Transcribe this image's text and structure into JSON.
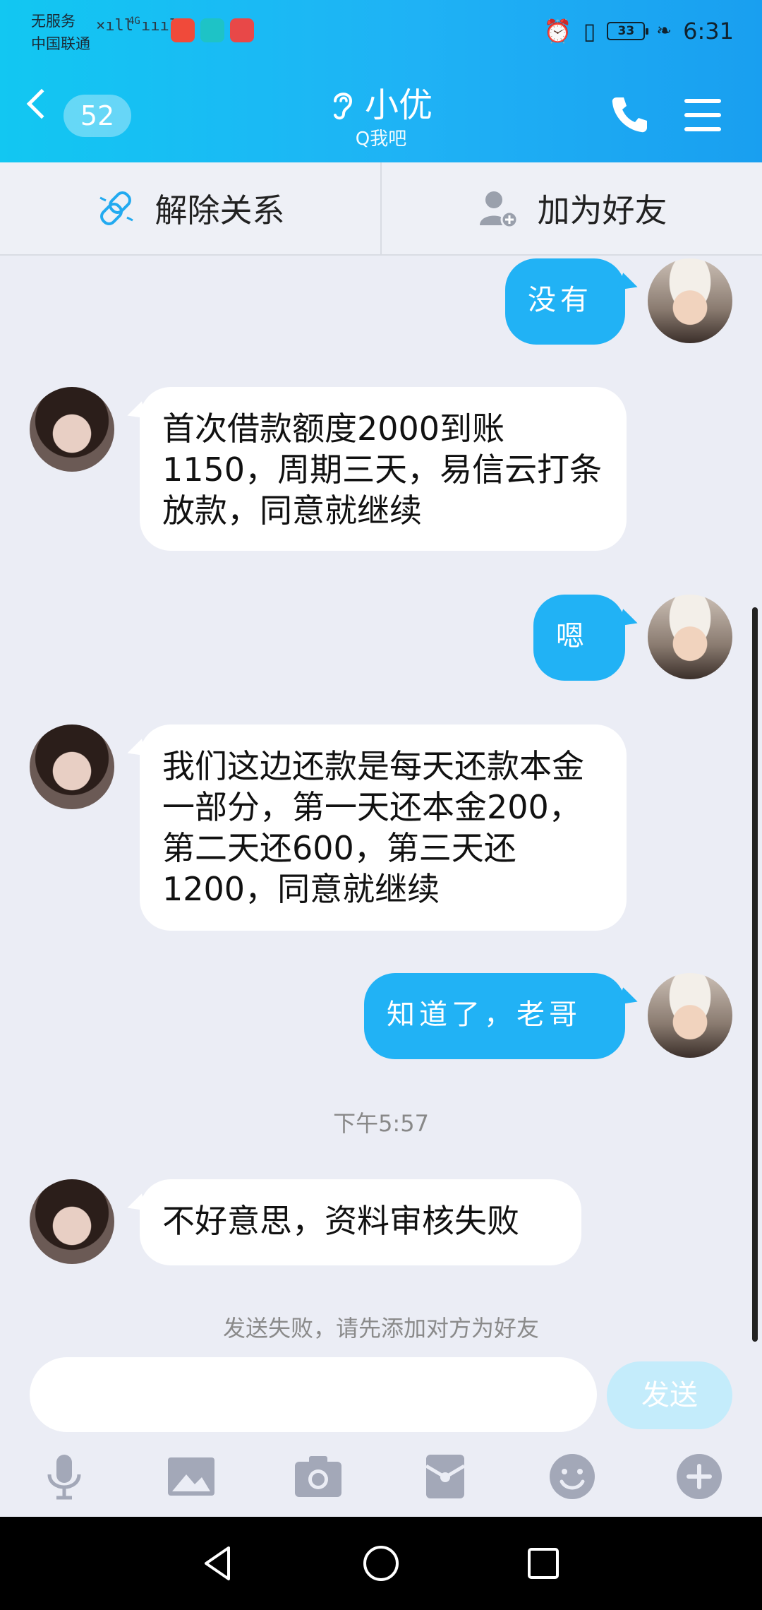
{
  "status": {
    "carrier_line1": "无服务",
    "carrier_line2": "中国联通",
    "network": "4G",
    "battery": "33",
    "time": "6:31"
  },
  "header": {
    "unread_count": "52",
    "title": "小优",
    "subtitle": "Q我吧",
    "ear_icon": "ear-icon",
    "phone_icon": "phone-icon",
    "menu_icon": "menu-icon"
  },
  "relation_bar": {
    "unlink_label": "解除关系",
    "add_friend_label": "加为好友"
  },
  "messages": [
    {
      "side": "right",
      "text": "没有"
    },
    {
      "side": "left",
      "text": "首次借款额度2000到账1150，周期三天，易信云打条放款，同意就继续"
    },
    {
      "side": "right",
      "text": "嗯"
    },
    {
      "side": "left",
      "text": "我们这边还款是每天还款本金一部分，第一天还本金200，第二天还600，第三天还1200，同意就继续"
    },
    {
      "side": "right",
      "text": "知道了，老哥"
    },
    {
      "side": "left",
      "text": "不好意思，资料审核失败"
    }
  ],
  "timestamp": "下午5:57",
  "fail_notice": "发送失败，请先添加对方为好友",
  "input": {
    "value": "",
    "send_label": "发送"
  },
  "tools": [
    "microphone-icon",
    "image-icon",
    "camera-icon",
    "red-packet-icon",
    "emoji-icon",
    "plus-icon"
  ],
  "colors": {
    "header_start": "#12c7f2",
    "header_end": "#199ff0",
    "bubble_right": "#21b2f5",
    "bubble_left": "#ffffff",
    "background": "#ebedf5"
  }
}
